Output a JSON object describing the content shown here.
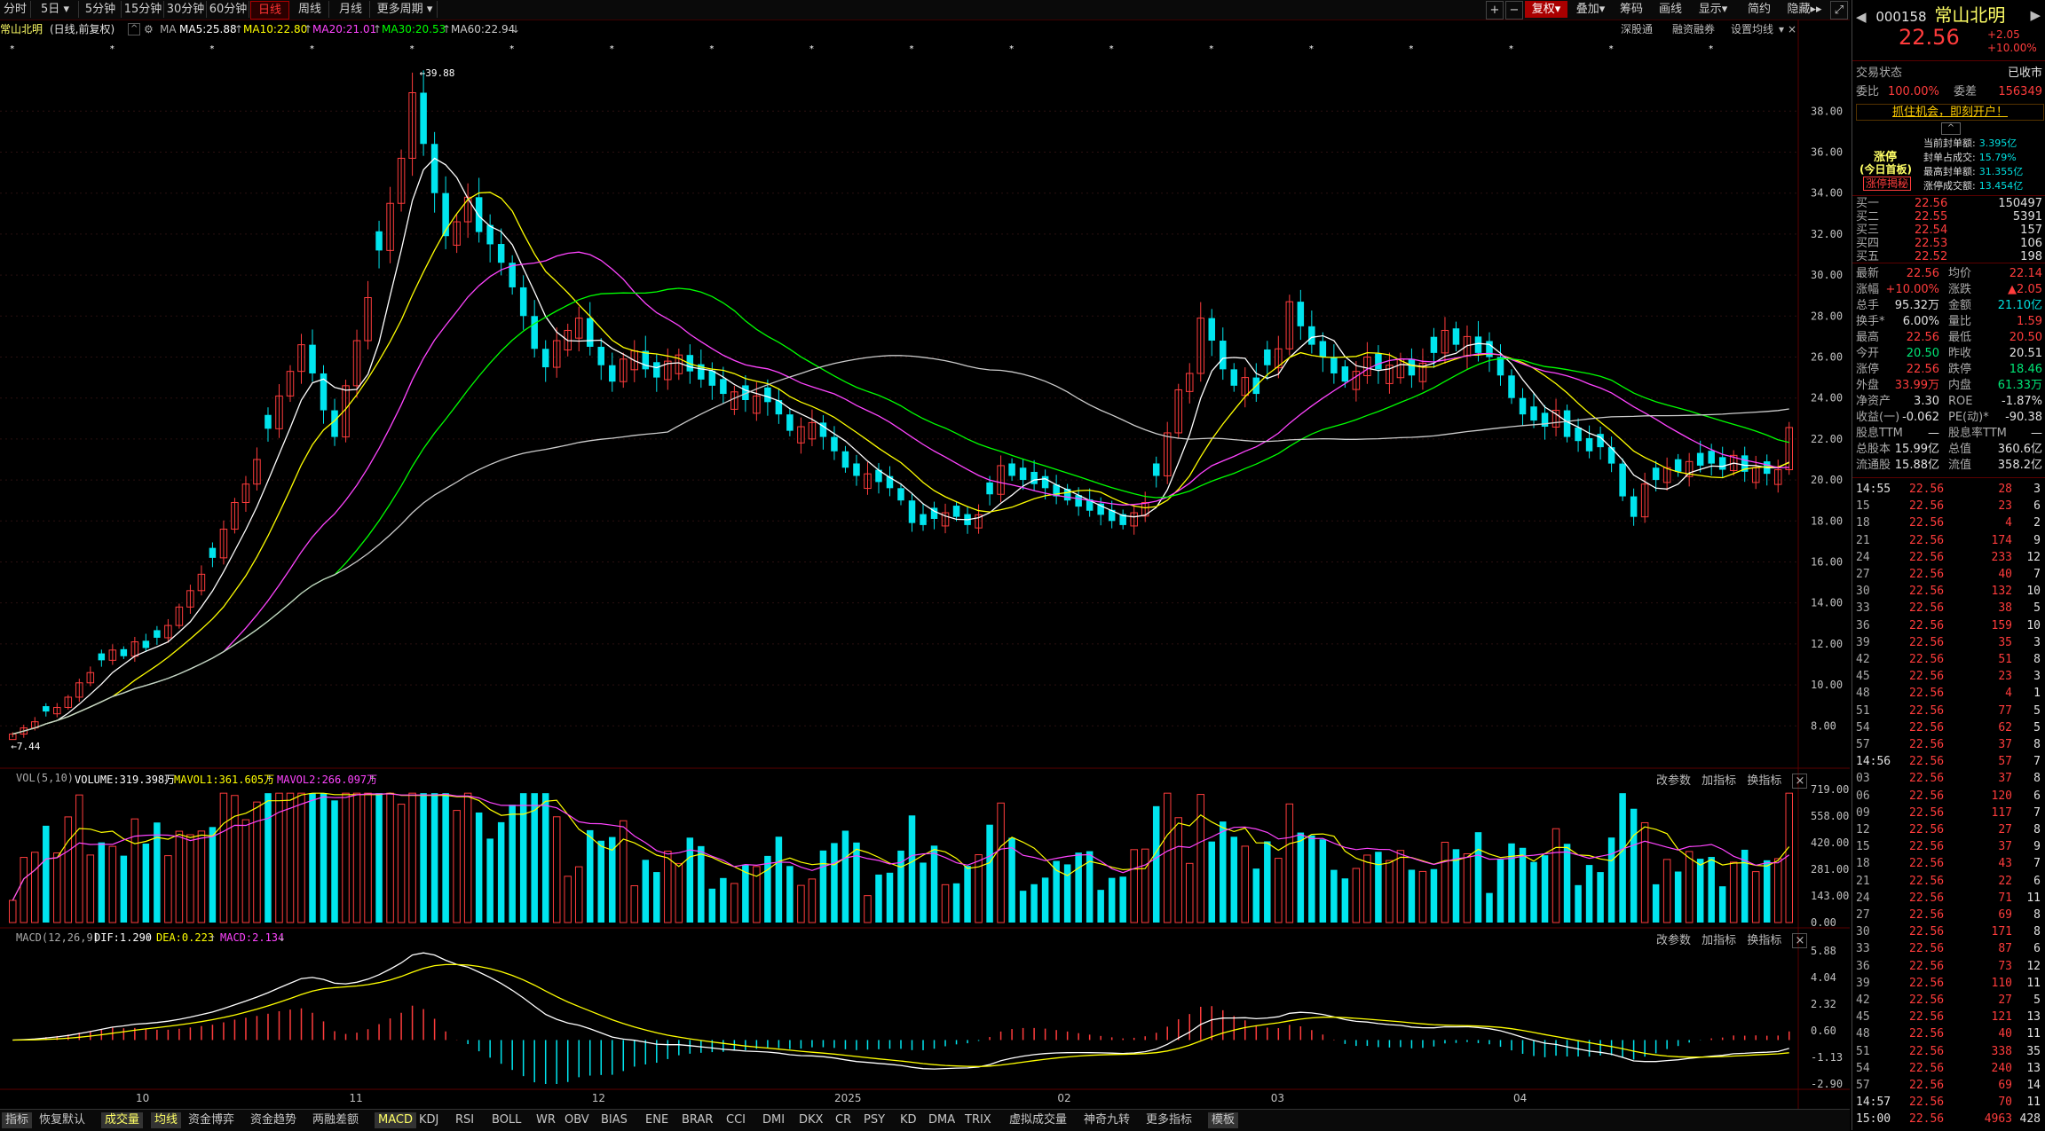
{
  "toolbar": {
    "periods": [
      "分时",
      "5日",
      "5分钟",
      "15分钟",
      "30分钟",
      "60分钟",
      "日线",
      "周线",
      "月线",
      "更多周期"
    ],
    "active_period": "日线",
    "tools": [
      "+",
      "−",
      "复权",
      "叠加",
      "筹码",
      "画线",
      "显示",
      "简约",
      "隐藏"
    ],
    "infobar_tools": [
      "深股通",
      "融资融券",
      "设置均线"
    ]
  },
  "header": {
    "stock_name": "常山北明",
    "mode": "(日线,前复权)",
    "ma_label": "MA",
    "ma5": "MA5:25.88",
    "ma10": "MA10:22.80",
    "ma20": "MA20:21.01",
    "ma30": "MA30:20.53",
    "ma60": "MA60:22.94"
  },
  "colors": {
    "ma5": "#ffffff",
    "ma10": "#ffff00",
    "ma20": "#ff44ff",
    "ma30": "#00ff00",
    "ma60": "#cccccc",
    "up": "#ff3c3c",
    "down": "#00e5ee"
  },
  "price_axis": [
    "38.00",
    "36.00",
    "34.00",
    "32.00",
    "30.00",
    "28.00",
    "26.00",
    "24.00",
    "22.00",
    "20.00",
    "18.00",
    "16.00",
    "14.00",
    "12.00",
    "10.00",
    "8.00"
  ],
  "high_marker": "39.88",
  "low_marker": "7.44",
  "vol": {
    "label": "VOL(5,10)",
    "volume": "VOLUME:319.398万",
    "mavol1": "MAVOL1:361.605万",
    "mavol2": "MAVOL2:266.097万",
    "axis": [
      "719.00",
      "558.00",
      "420.00",
      "281.00",
      "143.00",
      "0.00"
    ],
    "tools": [
      "改参数",
      "加指标",
      "换指标"
    ]
  },
  "macd": {
    "label": "MACD(12,26,9)",
    "dif": "DIF:1.290",
    "dea": "DEA:0.223",
    "macd": "MACD:2.134",
    "axis": [
      "5.88",
      "4.04",
      "2.32",
      "0.60",
      "-1.13",
      "-2.90"
    ],
    "tools": [
      "改参数",
      "加指标",
      "换指标"
    ]
  },
  "time_axis": [
    "10",
    "11",
    "12",
    "2025",
    "02",
    "03",
    "04"
  ],
  "bottom": {
    "items": [
      "指标",
      "恢复默认",
      "成交量",
      "均线",
      "资金博弈",
      "资金趋势",
      "两融差额",
      "MACD",
      "KDJ",
      "RSI",
      "BOLL",
      "WR",
      "OBV",
      "BIAS",
      "ENE",
      "BRAR",
      "CCI",
      "DMI",
      "DKX",
      "CR",
      "PSY",
      "KD",
      "DMA",
      "TRIX",
      "虚拟成交量",
      "神奇九转",
      "更多指标",
      "模板"
    ]
  },
  "quote": {
    "code": "000158",
    "name": "常山北明",
    "price": "22.56",
    "change": "+2.05",
    "change_pct": "+10.00%",
    "status_label": "交易状态",
    "status": "已收市",
    "weibi_label": "委比",
    "weibi": "100.00%",
    "weicha_label": "委差",
    "weicha": "156349",
    "promo": "抓住机会，即刻开户！",
    "limit_title": "涨停",
    "limit_sub": "(今日首板)",
    "limit_btn": "涨停揭秘",
    "limit_stats": [
      {
        "label": "当前封单额:",
        "value": "3.395亿"
      },
      {
        "label": "封单占成交:",
        "value": "15.79%"
      },
      {
        "label": "最高封单额:",
        "value": "31.355亿"
      },
      {
        "label": "涨停成交额:",
        "value": "13.454亿"
      }
    ],
    "buys": [
      {
        "label": "买一",
        "price": "22.56",
        "vol": "150497"
      },
      {
        "label": "买二",
        "price": "22.55",
        "vol": "5391"
      },
      {
        "label": "买三",
        "price": "22.54",
        "vol": "157"
      },
      {
        "label": "买四",
        "price": "22.53",
        "vol": "106"
      },
      {
        "label": "买五",
        "price": "22.52",
        "vol": "198"
      }
    ],
    "stats": [
      {
        "l1": "最新",
        "v1": "22.56",
        "c1": "red",
        "l2": "均价",
        "v2": "22.14",
        "c2": "red"
      },
      {
        "l1": "涨幅",
        "v1": "+10.00%",
        "c1": "red",
        "l2": "涨跌",
        "v2": "▲2.05",
        "c2": "red"
      },
      {
        "l1": "总手",
        "v1": "95.32万",
        "c1": "wht",
        "l2": "金额",
        "v2": "21.10亿",
        "c2": "cyan"
      },
      {
        "l1": "换手*",
        "v1": "6.00%",
        "c1": "wht",
        "l2": "量比",
        "v2": "1.59",
        "c2": "red"
      },
      {
        "l1": "最高",
        "v1": "22.56",
        "c1": "red",
        "l2": "最低",
        "v2": "20.50",
        "c2": "red"
      },
      {
        "l1": "今开",
        "v1": "20.50",
        "c1": "green",
        "l2": "昨收",
        "v2": "20.51",
        "c2": "wht"
      },
      {
        "l1": "涨停",
        "v1": "22.56",
        "c1": "red",
        "l2": "跌停",
        "v2": "18.46",
        "c2": "green"
      },
      {
        "l1": "外盘",
        "v1": "33.99万",
        "c1": "red",
        "l2": "内盘",
        "v2": "61.33万",
        "c2": "green"
      },
      {
        "l1": "净资产",
        "v1": "3.30",
        "c1": "wht",
        "l2": "ROE",
        "v2": "-1.87%",
        "c2": "wht"
      },
      {
        "l1": "收益(一)",
        "v1": "-0.062",
        "c1": "wht",
        "l2": "PE(动)*",
        "v2": "-90.38",
        "c2": "wht"
      },
      {
        "l1": "股息TTM",
        "v1": "—",
        "c1": "wht",
        "l2": "股息率TTM",
        "v2": "—",
        "c2": "wht"
      },
      {
        "l1": "总股本",
        "v1": "15.99亿",
        "c1": "wht",
        "l2": "总值",
        "v2": "360.6亿",
        "c2": "wht"
      },
      {
        "l1": "流通股",
        "v1": "15.88亿",
        "c1": "wht",
        "l2": "流值",
        "v2": "358.2亿",
        "c2": "wht"
      }
    ],
    "ticks": [
      {
        "t": "14:55",
        "p": "22.56",
        "v": "28",
        "n": "3"
      },
      {
        "t": "15",
        "p": "22.56",
        "v": "23",
        "n": "6"
      },
      {
        "t": "18",
        "p": "22.56",
        "v": "4",
        "n": "2"
      },
      {
        "t": "21",
        "p": "22.56",
        "v": "174",
        "n": "9"
      },
      {
        "t": "24",
        "p": "22.56",
        "v": "233",
        "n": "12"
      },
      {
        "t": "27",
        "p": "22.56",
        "v": "40",
        "n": "7"
      },
      {
        "t": "30",
        "p": "22.56",
        "v": "132",
        "n": "10"
      },
      {
        "t": "33",
        "p": "22.56",
        "v": "38",
        "n": "5"
      },
      {
        "t": "36",
        "p": "22.56",
        "v": "159",
        "n": "10"
      },
      {
        "t": "39",
        "p": "22.56",
        "v": "35",
        "n": "3"
      },
      {
        "t": "42",
        "p": "22.56",
        "v": "51",
        "n": "8"
      },
      {
        "t": "45",
        "p": "22.56",
        "v": "23",
        "n": "3"
      },
      {
        "t": "48",
        "p": "22.56",
        "v": "4",
        "n": "1"
      },
      {
        "t": "51",
        "p": "22.56",
        "v": "77",
        "n": "5"
      },
      {
        "t": "54",
        "p": "22.56",
        "v": "62",
        "n": "5"
      },
      {
        "t": "57",
        "p": "22.56",
        "v": "37",
        "n": "8"
      },
      {
        "t": "14:56",
        "p": "22.56",
        "v": "57",
        "n": "7"
      },
      {
        "t": "03",
        "p": "22.56",
        "v": "37",
        "n": "8"
      },
      {
        "t": "06",
        "p": "22.56",
        "v": "120",
        "n": "6"
      },
      {
        "t": "09",
        "p": "22.56",
        "v": "117",
        "n": "7"
      },
      {
        "t": "12",
        "p": "22.56",
        "v": "27",
        "n": "8"
      },
      {
        "t": "15",
        "p": "22.56",
        "v": "37",
        "n": "9"
      },
      {
        "t": "18",
        "p": "22.56",
        "v": "43",
        "n": "7"
      },
      {
        "t": "21",
        "p": "22.56",
        "v": "22",
        "n": "6"
      },
      {
        "t": "24",
        "p": "22.56",
        "v": "71",
        "n": "11"
      },
      {
        "t": "27",
        "p": "22.56",
        "v": "69",
        "n": "8"
      },
      {
        "t": "30",
        "p": "22.56",
        "v": "171",
        "n": "8"
      },
      {
        "t": "33",
        "p": "22.56",
        "v": "87",
        "n": "6"
      },
      {
        "t": "36",
        "p": "22.56",
        "v": "73",
        "n": "12"
      },
      {
        "t": "39",
        "p": "22.56",
        "v": "110",
        "n": "11"
      },
      {
        "t": "42",
        "p": "22.56",
        "v": "27",
        "n": "5"
      },
      {
        "t": "45",
        "p": "22.56",
        "v": "121",
        "n": "13"
      },
      {
        "t": "48",
        "p": "22.56",
        "v": "40",
        "n": "11"
      },
      {
        "t": "51",
        "p": "22.56",
        "v": "338",
        "n": "35"
      },
      {
        "t": "54",
        "p": "22.56",
        "v": "240",
        "n": "13"
      },
      {
        "t": "57",
        "p": "22.56",
        "v": "69",
        "n": "14"
      },
      {
        "t": "14:57",
        "p": "22.56",
        "v": "70",
        "n": "11"
      },
      {
        "t": "15:00",
        "p": "22.56",
        "v": "4963",
        "n": "428"
      }
    ]
  },
  "chart_data": {
    "type": "candlestick",
    "title": "常山北明",
    "ylim": [
      6.8,
      41.0
    ],
    "x_labels": [
      "10",
      "11",
      "12",
      "2025",
      "02",
      "03",
      "04"
    ],
    "closes": [
      7.6,
      7.9,
      8.2,
      8.7,
      8.9,
      9.4,
      10.1,
      10.6,
      11.2,
      11.7,
      11.4,
      12.1,
      11.8,
      12.3,
      12.9,
      13.8,
      14.6,
      15.4,
      16.2,
      17.6,
      18.9,
      19.8,
      21.0,
      22.5,
      24.1,
      25.3,
      26.6,
      25.2,
      23.4,
      22.1,
      24.6,
      26.8,
      28.9,
      31.2,
      33.5,
      35.7,
      38.9,
      36.4,
      34.0,
      31.9,
      32.6,
      33.8,
      32.1,
      31.5,
      30.6,
      29.4,
      28.0,
      26.4,
      25.5,
      26.8,
      27.3,
      27.9,
      26.5,
      25.6,
      24.8,
      25.9,
      26.3,
      25.4,
      25.0,
      25.8,
      26.1,
      25.3,
      24.9,
      24.6,
      24.2,
      24.3,
      23.9,
      24.1,
      23.8,
      23.2,
      22.4,
      22.6,
      22.8,
      22.1,
      21.4,
      20.6,
      20.2,
      20.3,
      19.9,
      19.6,
      19.0,
      17.9,
      17.8,
      18.1,
      18.4,
      18.2,
      17.8,
      18.3,
      19.3,
      20.7,
      20.2,
      20.0,
      19.8,
      19.6,
      19.2,
      19.0,
      18.7,
      18.5,
      18.3,
      18.0,
      17.8,
      18.4,
      18.9,
      20.2,
      22.3,
      24.4,
      25.2,
      27.9,
      26.8,
      25.4,
      24.6,
      25.0,
      24.2,
      25.6,
      26.4,
      28.7,
      27.5,
      26.6,
      26.0,
      25.2,
      24.8,
      25.3,
      26.0,
      25.4,
      25.6,
      25.9,
      25.1,
      25.7,
      26.2,
      27.3,
      26.6,
      27.0,
      26.2,
      26.0,
      25.1,
      24.0,
      23.2,
      22.9,
      22.6,
      23.4,
      22.1,
      21.9,
      21.4,
      21.6,
      20.8,
      19.2,
      18.2,
      19.8,
      20.0,
      20.6,
      20.4,
      20.9,
      20.7,
      20.8,
      20.5,
      21.2,
      20.4,
      20.6,
      20.3,
      20.5,
      22.56
    ]
  }
}
